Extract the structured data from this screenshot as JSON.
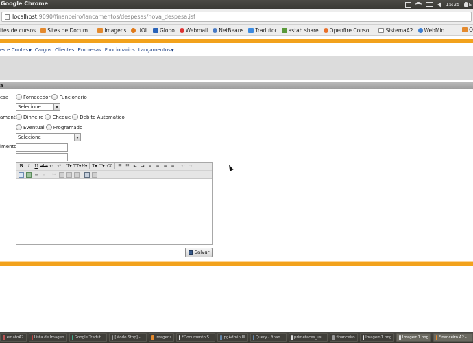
{
  "os": {
    "title": "Google Chrome",
    "clock": "15:25",
    "user_initial": "E"
  },
  "browser": {
    "url_host": "localhost",
    "url_path": ":9090/financeiro/lancamentos/despesas/nova_despesa.jsf",
    "bookmarks": [
      {
        "label": "ites de cursos",
        "icon": "folder"
      },
      {
        "label": "Sites de Docum...",
        "icon": "folder"
      },
      {
        "label": "Imagens",
        "icon": "folder"
      },
      {
        "label": "UOL",
        "icon": "uol"
      },
      {
        "label": "Globo",
        "icon": "globo"
      },
      {
        "label": "Webmail",
        "icon": "webmail"
      },
      {
        "label": "NetBeans",
        "icon": "netbeans"
      },
      {
        "label": "Tradutor",
        "icon": "tradutor"
      },
      {
        "label": "astah share",
        "icon": "astah"
      },
      {
        "label": "Openfire Conso...",
        "icon": "openfire"
      },
      {
        "label": "SistemaA2",
        "icon": "page"
      },
      {
        "label": "WebMin",
        "icon": "webmin"
      }
    ],
    "bookmark_more": "O"
  },
  "app": {
    "menu": [
      {
        "label": "es e Contas",
        "dropdown": true
      },
      {
        "label": "Cargos",
        "dropdown": false
      },
      {
        "label": "Clientes",
        "dropdown": false
      },
      {
        "label": "Empresas",
        "dropdown": false
      },
      {
        "label": "Funcionarios",
        "dropdown": false
      },
      {
        "label": "Lançamentos",
        "dropdown": true
      }
    ],
    "panel_title": "a",
    "form": {
      "label_tipo": "esa",
      "radio_fornecedor": "Fornecedor",
      "radio_funcionario": "Funcionario",
      "select_1": "Selecione",
      "label_pagamento": "amento",
      "radio_dinheiro": "Dinheiro",
      "radio_cheque": "Cheque",
      "radio_debito": "Debito Automatico",
      "radio_eventual": "Eventual",
      "radio_programado": "Programado",
      "select_2": "Selecione",
      "label_vencimento": "imento",
      "save_label": "Salvar"
    }
  },
  "taskbar": {
    "items": [
      {
        "label": "ematoA2",
        "color": "#b55"
      },
      {
        "label": "Lista de Imagen",
        "color": "#b44"
      },
      {
        "label": "Google Tradut...",
        "color": "#4a8"
      },
      {
        "label": "[Modo Stop] -...",
        "color": "#999"
      },
      {
        "label": "Imagens",
        "color": "#e48a2e"
      },
      {
        "label": "*Documento S...",
        "color": "#ddd"
      },
      {
        "label": "pgAdmin III",
        "color": "#68a"
      },
      {
        "label": "Query - finan...",
        "color": "#68a"
      },
      {
        "label": "primefaces_us...",
        "color": "#ddd"
      },
      {
        "label": "financeiro",
        "color": "#999"
      },
      {
        "label": "Imagem1.png",
        "color": "#ddd"
      },
      {
        "label": "Imagem1.png",
        "color": "#ddd",
        "active": true
      },
      {
        "label": "Financeiro A2 -...",
        "color": "#e48a2e",
        "active": true
      }
    ]
  }
}
